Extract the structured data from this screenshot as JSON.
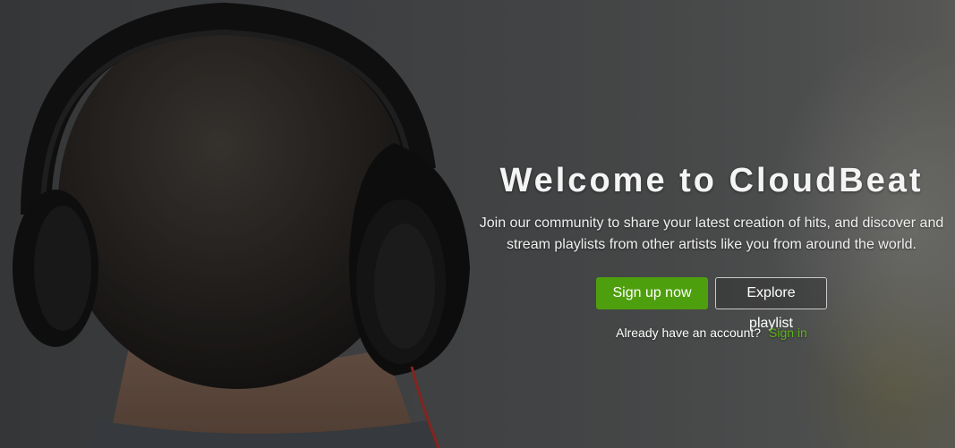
{
  "hero": {
    "title": "Welcome to CloudBeat",
    "description": "Join our community to share your latest creation of hits, and discover and stream playlists from other artists like you from around the world.",
    "primary_button_label": "Sign up now",
    "secondary_button_label": "Explore playlist",
    "signin_prompt": "Already have an account?",
    "signin_link_label": "Sign in"
  },
  "colors": {
    "accent": "#4e9f0d",
    "link": "#5cb515",
    "text": "#ffffff"
  },
  "icons": {
    "background": "person-with-headphones-photo"
  }
}
